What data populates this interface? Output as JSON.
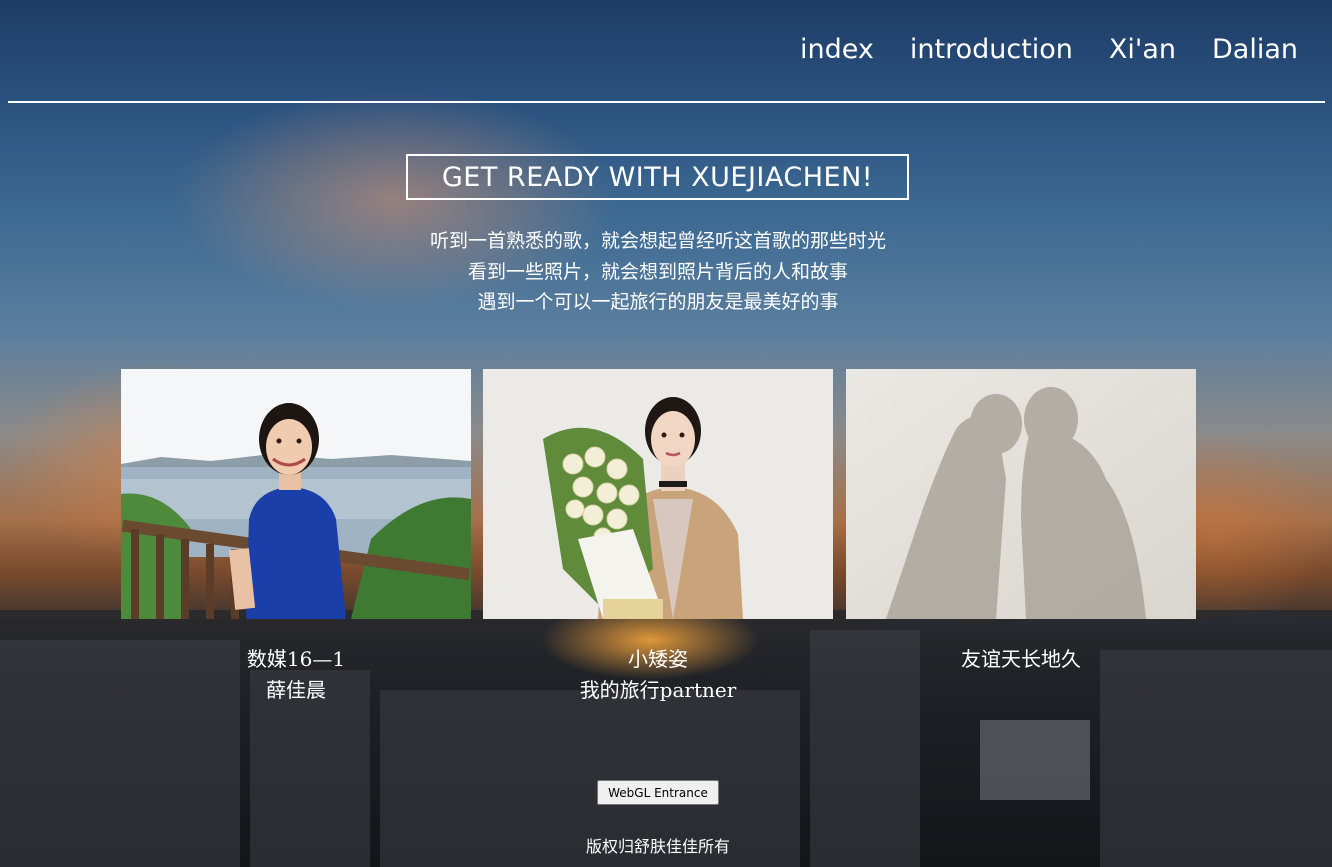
{
  "nav": {
    "items": [
      {
        "label": "index"
      },
      {
        "label": "introduction"
      },
      {
        "label": "Xi'an"
      },
      {
        "label": "Dalian"
      }
    ]
  },
  "hero": {
    "title": "GET READY WITH XUEJIACHEN!",
    "lines": [
      "听到一首熟悉的歌，就会想起曾经听这首歌的那些时光",
      "看到一些照片，就会想到照片背后的人和故事",
      "遇到一个可以一起旅行的朋友是最美好的事"
    ]
  },
  "cards": [
    {
      "line1": "数媒16—1",
      "line2": "薛佳晨",
      "image": "girl-by-sea-photo"
    },
    {
      "line1": "小矮姿",
      "line2": "我的旅行partner",
      "image": "girl-with-flowers-photo"
    },
    {
      "line1": "友谊天长地久",
      "line2": "",
      "image": "shadow-silhouettes-photo"
    }
  ],
  "button": {
    "label": "WebGL Entrance"
  },
  "footer": {
    "text": "版权归舒肤佳佳所有"
  },
  "colors": {
    "text": "#ffffff",
    "sky_top": "#1d3c66",
    "sunset": "#e0803c"
  }
}
